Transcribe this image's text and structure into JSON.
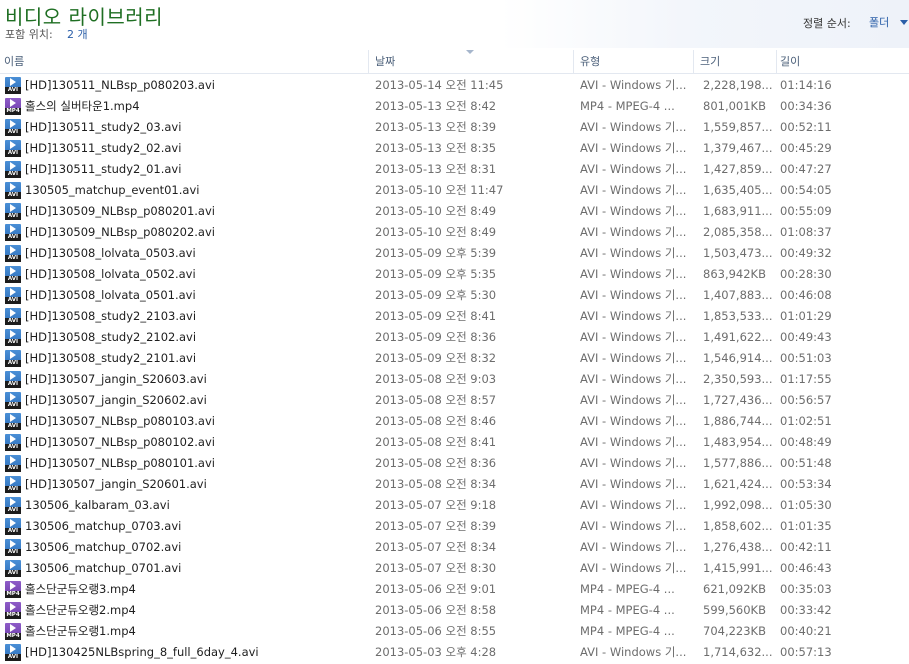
{
  "header": {
    "title": "비디오 라이브러리",
    "includes_label": "포함 위치:",
    "includes_link": "2 개",
    "sort_label": "정렬 순서:",
    "sort_value": "폴더"
  },
  "columns": {
    "name": "이름",
    "date": "날짜",
    "type": "유형",
    "size": "크기",
    "length": "길이"
  },
  "files": [
    {
      "name": "[HD]130511_NLBsp_p080203.avi",
      "date": "2013-05-14 오전 11:45",
      "type": "AVI - Windows 기...",
      "size": "2,228,198...",
      "length": "01:14:16",
      "icon": "avi"
    },
    {
      "name": "홀스의 실버타운1.mp4",
      "date": "2013-05-13 오전 8:42",
      "type": "MP4 - MPEG-4 ...",
      "size": "801,001KB",
      "length": "00:34:36",
      "icon": "mp4"
    },
    {
      "name": "[HD]130511_study2_03.avi",
      "date": "2013-05-13 오전 8:39",
      "type": "AVI - Windows 기...",
      "size": "1,559,857...",
      "length": "00:52:11",
      "icon": "avi"
    },
    {
      "name": "[HD]130511_study2_02.avi",
      "date": "2013-05-13 오전 8:35",
      "type": "AVI - Windows 기...",
      "size": "1,379,467...",
      "length": "00:45:29",
      "icon": "avi"
    },
    {
      "name": "[HD]130511_study2_01.avi",
      "date": "2013-05-13 오전 8:31",
      "type": "AVI - Windows 기...",
      "size": "1,427,859...",
      "length": "00:47:27",
      "icon": "avi"
    },
    {
      "name": "130505_matchup_event01.avi",
      "date": "2013-05-10 오전 11:47",
      "type": "AVI - Windows 기...",
      "size": "1,635,405...",
      "length": "00:54:05",
      "icon": "avi"
    },
    {
      "name": "[HD]130509_NLBsp_p080201.avi",
      "date": "2013-05-10 오전 8:49",
      "type": "AVI - Windows 기...",
      "size": "1,683,911...",
      "length": "00:55:09",
      "icon": "avi"
    },
    {
      "name": "[HD]130509_NLBsp_p080202.avi",
      "date": "2013-05-10 오전 8:49",
      "type": "AVI - Windows 기...",
      "size": "2,085,358...",
      "length": "01:08:37",
      "icon": "avi"
    },
    {
      "name": "[HD]130508_lolvata_0503.avi",
      "date": "2013-05-09 오후 5:39",
      "type": "AVI - Windows 기...",
      "size": "1,503,473...",
      "length": "00:49:32",
      "icon": "avi"
    },
    {
      "name": "[HD]130508_lolvata_0502.avi",
      "date": "2013-05-09 오후 5:35",
      "type": "AVI - Windows 기...",
      "size": "863,942KB",
      "length": "00:28:30",
      "icon": "avi"
    },
    {
      "name": "[HD]130508_lolvata_0501.avi",
      "date": "2013-05-09 오후 5:30",
      "type": "AVI - Windows 기...",
      "size": "1,407,883...",
      "length": "00:46:08",
      "icon": "avi"
    },
    {
      "name": "[HD]130508_study2_2103.avi",
      "date": "2013-05-09 오전 8:41",
      "type": "AVI - Windows 기...",
      "size": "1,853,533...",
      "length": "01:01:29",
      "icon": "avi"
    },
    {
      "name": "[HD]130508_study2_2102.avi",
      "date": "2013-05-09 오전 8:36",
      "type": "AVI - Windows 기...",
      "size": "1,491,622...",
      "length": "00:49:43",
      "icon": "avi"
    },
    {
      "name": "[HD]130508_study2_2101.avi",
      "date": "2013-05-09 오전 8:32",
      "type": "AVI - Windows 기...",
      "size": "1,546,914...",
      "length": "00:51:03",
      "icon": "avi"
    },
    {
      "name": "[HD]130507_jangin_S20603.avi",
      "date": "2013-05-08 오전 9:03",
      "type": "AVI - Windows 기...",
      "size": "2,350,593...",
      "length": "01:17:55",
      "icon": "avi"
    },
    {
      "name": "[HD]130507_jangin_S20602.avi",
      "date": "2013-05-08 오전 8:57",
      "type": "AVI - Windows 기...",
      "size": "1,727,436...",
      "length": "00:56:57",
      "icon": "avi"
    },
    {
      "name": "[HD]130507_NLBsp_p080103.avi",
      "date": "2013-05-08 오전 8:46",
      "type": "AVI - Windows 기...",
      "size": "1,886,744...",
      "length": "01:02:51",
      "icon": "avi"
    },
    {
      "name": "[HD]130507_NLBsp_p080102.avi",
      "date": "2013-05-08 오전 8:41",
      "type": "AVI - Windows 기...",
      "size": "1,483,954...",
      "length": "00:48:49",
      "icon": "avi"
    },
    {
      "name": "[HD]130507_NLBsp_p080101.avi",
      "date": "2013-05-08 오전 8:36",
      "type": "AVI - Windows 기...",
      "size": "1,577,886...",
      "length": "00:51:48",
      "icon": "avi"
    },
    {
      "name": "[HD]130507_jangin_S20601.avi",
      "date": "2013-05-08 오전 8:34",
      "type": "AVI - Windows 기...",
      "size": "1,621,424...",
      "length": "00:53:34",
      "icon": "avi"
    },
    {
      "name": "130506_kalbaram_03.avi",
      "date": "2013-05-07 오전 9:18",
      "type": "AVI - Windows 기...",
      "size": "1,992,098...",
      "length": "01:05:30",
      "icon": "avi"
    },
    {
      "name": "130506_matchup_0703.avi",
      "date": "2013-05-07 오전 8:39",
      "type": "AVI - Windows 기...",
      "size": "1,858,602...",
      "length": "01:01:35",
      "icon": "avi"
    },
    {
      "name": "130506_matchup_0702.avi",
      "date": "2013-05-07 오전 8:34",
      "type": "AVI - Windows 기...",
      "size": "1,276,438...",
      "length": "00:42:11",
      "icon": "avi"
    },
    {
      "name": "130506_matchup_0701.avi",
      "date": "2013-05-07 오전 8:30",
      "type": "AVI - Windows 기...",
      "size": "1,415,991...",
      "length": "00:46:43",
      "icon": "avi"
    },
    {
      "name": "홀스단군듀오랭3.mp4",
      "date": "2013-05-06 오전 9:01",
      "type": "MP4 - MPEG-4 ...",
      "size": "621,092KB",
      "length": "00:35:03",
      "icon": "mp4"
    },
    {
      "name": "홀스단군듀오랭2.mp4",
      "date": "2013-05-06 오전 8:58",
      "type": "MP4 - MPEG-4 ...",
      "size": "599,560KB",
      "length": "00:33:42",
      "icon": "mp4"
    },
    {
      "name": "홀스단군듀오랭1.mp4",
      "date": "2013-05-06 오전 8:55",
      "type": "MP4 - MPEG-4 ...",
      "size": "704,223KB",
      "length": "00:40:21",
      "icon": "mp4"
    },
    {
      "name": "[HD]130425NLBspring_8_full_6day_4.avi",
      "date": "2013-05-03 오후 4:28",
      "type": "AVI - Windows 기...",
      "size": "1,714,632...",
      "length": "00:57:13",
      "icon": "avi"
    }
  ],
  "icon_tags": {
    "avi": "AVI",
    "mp4": "MP4"
  }
}
